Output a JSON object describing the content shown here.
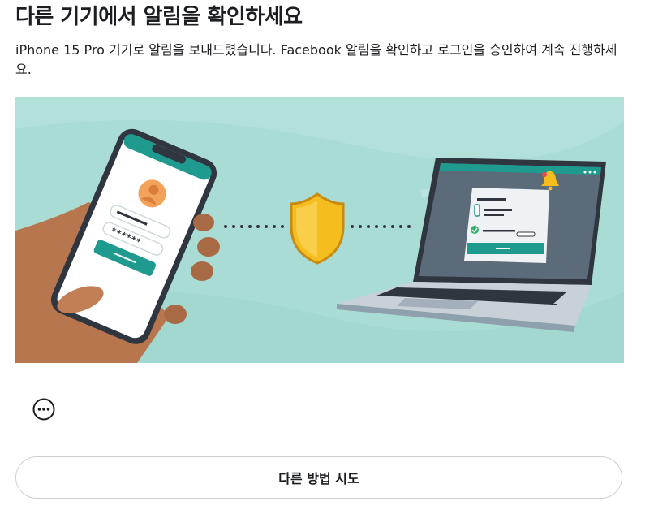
{
  "header": {
    "title": "다른 기기에서 알림을 확인하세요",
    "description": "iPhone 15 Pro 기기로 알림을 보내드렸습니다. Facebook 알림을 확인하고 로그인을 승인하여 계속 진행하세요."
  },
  "illustration": {
    "password_mask": "******",
    "colors": {
      "background": "#a9dcd4",
      "teal": "#1f9a8e",
      "shield": "#f6bd1e",
      "laptop": "#2f3640",
      "skin": "#b8764e"
    }
  },
  "status": {
    "icon": "loading-ellipsis-icon"
  },
  "actions": {
    "try_another_way_label": "다른 방법 시도"
  }
}
